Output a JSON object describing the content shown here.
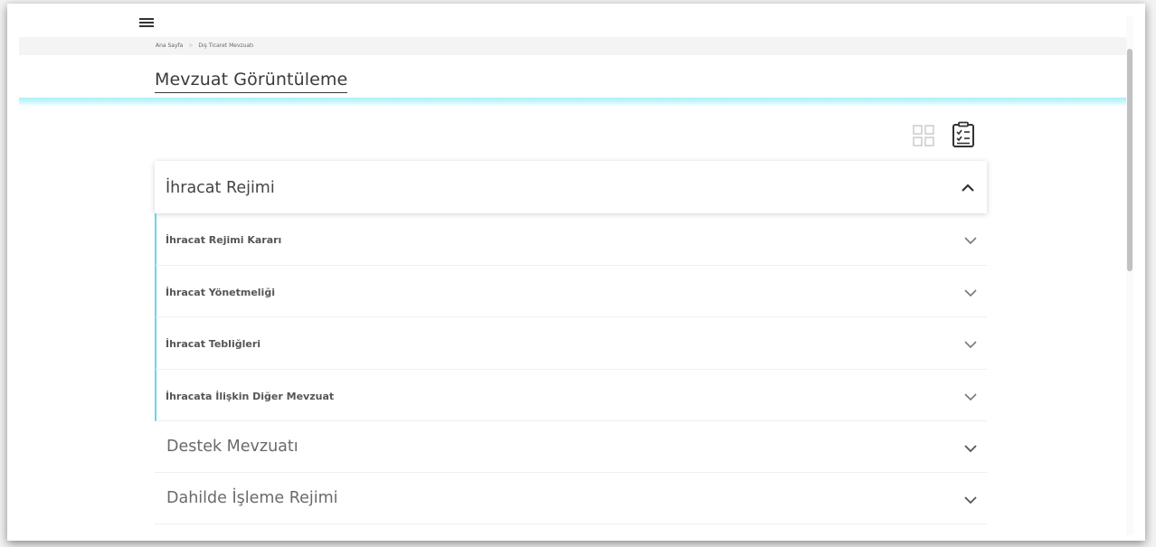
{
  "header": {
    "menu_icon": "hamburger-icon"
  },
  "breadcrumb": {
    "home": "Ana Sayfa",
    "separator": ">",
    "current": "Dış Ticaret Mevzuatı"
  },
  "page": {
    "title": "Mevzuat Görüntüleme",
    "accent_color": "#6bd3ea"
  },
  "view_toggles": {
    "grid_icon": "grid-view-icon",
    "list_icon": "checklist-view-icon"
  },
  "sections": {
    "expanded": {
      "title": "İhracat Rejimi",
      "items": [
        {
          "label": "İhracat Rejimi Kararı"
        },
        {
          "label": "İhracat Yönetmeliği"
        },
        {
          "label": "İhracat Tebliğleri"
        },
        {
          "label": "İhracata İlişkin Diğer Mevzuat"
        }
      ]
    },
    "collapsed": [
      {
        "title": "Destek Mevzuatı"
      },
      {
        "title": "Dahilde İşleme Rejimi"
      }
    ]
  }
}
